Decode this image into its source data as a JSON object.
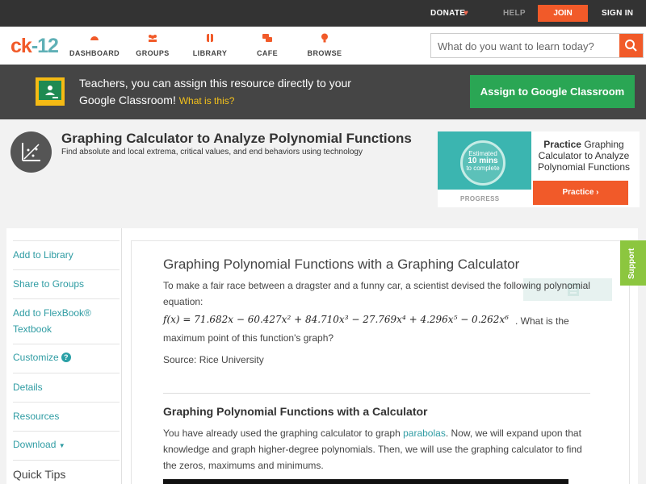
{
  "topbar": {
    "donate": "DONATE",
    "help": "HELP",
    "join": "JOIN",
    "signin": "SIGN IN"
  },
  "header": {
    "logo_c": "ck",
    "logo_dash": "-",
    "logo_12": "12",
    "nav": [
      {
        "label": "DASHBOARD",
        "icon": "dashboard-icon"
      },
      {
        "label": "GROUPS",
        "icon": "groups-icon"
      },
      {
        "label": "LIBRARY",
        "icon": "library-icon"
      },
      {
        "label": "CAFE",
        "icon": "cafe-icon"
      },
      {
        "label": "BROWSE",
        "icon": "browse-icon"
      }
    ],
    "search_placeholder": "What do you want to learn today?"
  },
  "teacher_banner": {
    "text": "Teachers, you can assign this resource directly to your Google Classroom!",
    "what_link": "What is this?",
    "assign_button": "Assign to Google Classroom"
  },
  "concept": {
    "title": "Graphing Calculator to Analyze Polynomial Functions",
    "subtitle": "Find absolute and local extrema, critical values, and end behaviors using technology"
  },
  "practice_card": {
    "estimated_line1": "Estimated",
    "estimated_line2": "10 mins",
    "estimated_line3": "to complete",
    "progress_label": "PROGRESS",
    "practice_word": "Practice",
    "practice_desc": "Graphing Calculator to Analyze Polynomial Functions",
    "practice_button": "Practice"
  },
  "sidebar": {
    "items": [
      {
        "label": "Add to Library"
      },
      {
        "label": "Share to Groups"
      },
      {
        "label": "Add to FlexBook® Textbook"
      },
      {
        "label": "Customize"
      },
      {
        "label": "Details"
      },
      {
        "label": "Resources"
      },
      {
        "label": "Download"
      }
    ],
    "quick_tips": "Quick Tips"
  },
  "content": {
    "title": "Graphing Polynomial Functions with a Graphing Calculator",
    "intro": "To make a fair race between a dragster and a funny car, a scientist devised the following polynomial equation:",
    "equation": "f(x) = 71.682x − 60.427x² + 84.710x³ − 27.769x⁴ + 4.296x⁵ − 0.262x⁶",
    "question_start": ". What is the",
    "question_end": "maximum point of this function's graph?",
    "source": "Source: Rice University",
    "section_heading": "Graphing Polynomial Functions with a Calculator",
    "section_text_1": "You have already used the graphing calculator to graph",
    "section_link": "parabolas",
    "section_text_2": ". Now, we will expand upon that knowledge and graph higher-degree polynomials. Then, we will use the graphing calculator to find the zeros, maximums and minimums."
  },
  "support_tab": "Support",
  "colors": {
    "accent_orange": "#f15a29",
    "teal": "#2f9ca3",
    "green": "#2aa654",
    "dark": "#333333"
  }
}
